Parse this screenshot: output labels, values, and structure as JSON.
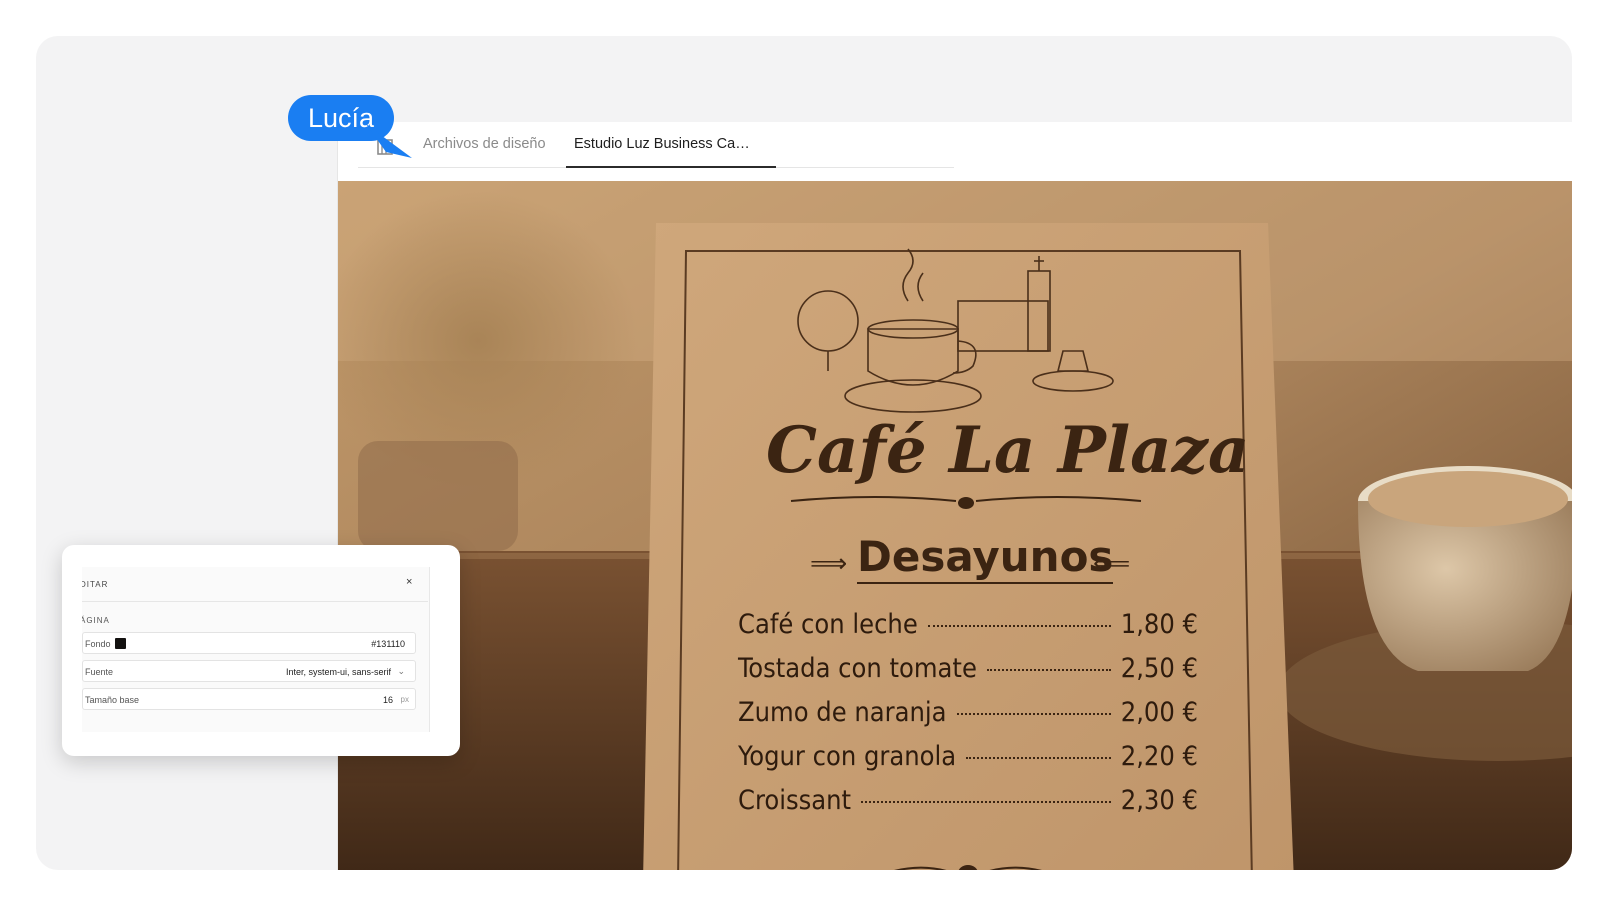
{
  "cursor": {
    "name": "Lucía",
    "color": "#1a7ef2"
  },
  "tabs": {
    "items": [
      {
        "label": "Archivos de diseño",
        "active": false
      },
      {
        "label": "Estudio Luz Business Ca…",
        "active": true
      }
    ]
  },
  "menu_card": {
    "title": "Café La Plaza",
    "section": "Desayunos",
    "items": [
      {
        "name": "Café con leche",
        "price": "1,80 €"
      },
      {
        "name": "Tostada con tomate",
        "price": "2,50 €"
      },
      {
        "name": "Zumo de naranja",
        "price": "2,00 €"
      },
      {
        "name": "Yogur con granola",
        "price": "2,20 €"
      },
      {
        "name": "Croissant",
        "price": "2,30 €"
      }
    ]
  },
  "edit_panel": {
    "title": "DITAR",
    "close_symbol": "×",
    "section": "ÁGINA",
    "background": {
      "label": "Fondo",
      "value": "#131110",
      "swatch_color": "#131110"
    },
    "font": {
      "label": "Fuente",
      "value": "Inter, system-ui, sans-serif"
    },
    "base_size": {
      "label": "Tamaño base",
      "value": "16",
      "unit": "px"
    }
  }
}
